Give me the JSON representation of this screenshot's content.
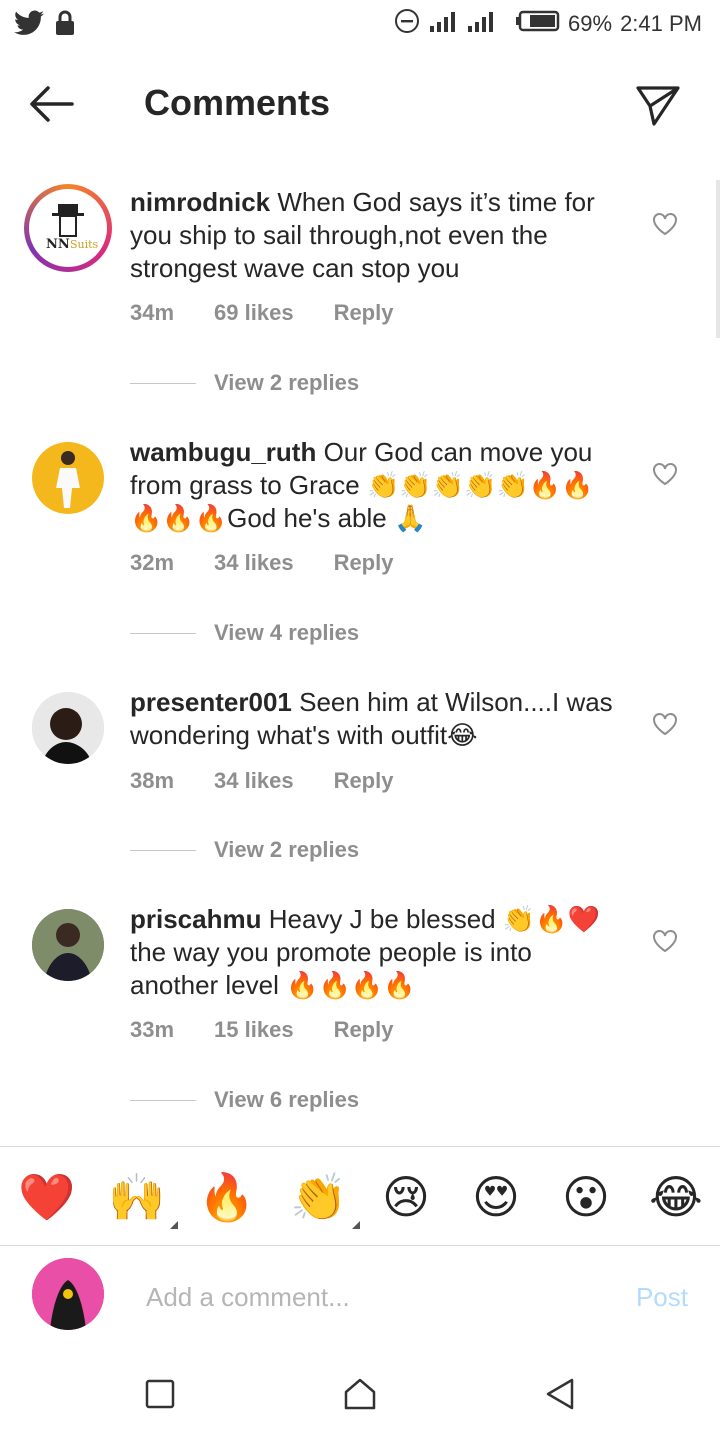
{
  "status_bar": {
    "battery": "69%",
    "time": "2:41 PM"
  },
  "header": {
    "title": "Comments"
  },
  "comments": [
    {
      "username": "nimrodnick",
      "text": "When God says it’s time for you ship to sail through,not even the strongest wave can stop you",
      "time": "34m",
      "likes": "69 likes",
      "reply": "Reply",
      "view_replies": "View 2 replies"
    },
    {
      "username": "wambugu_ruth",
      "text": "Our God can move you from grass to Grace 👏👏👏👏👏🔥🔥🔥🔥🔥God he's able 🙏",
      "time": "32m",
      "likes": "34 likes",
      "reply": "Reply",
      "view_replies": "View 4 replies"
    },
    {
      "username": "presenter001",
      "text": "Seen him at Wilson....I was wondering what's with outfit😂",
      "time": "38m",
      "likes": "34 likes",
      "reply": "Reply",
      "view_replies": "View 2 replies"
    },
    {
      "username": "priscahmu",
      "text": "Heavy J be blessed 👏🔥❤️ the way you promote people is into another level 🔥🔥🔥🔥",
      "time": "33m",
      "likes": "15 likes",
      "reply": "Reply",
      "view_replies": "View 6 replies"
    }
  ],
  "reactions": [
    "❤️",
    "🙌",
    "🔥",
    "👏",
    "😢",
    "😍",
    "😮",
    "😂"
  ],
  "composer": {
    "placeholder": "Add a comment...",
    "post_label": "Post"
  },
  "colors": {
    "accent_disabled": "#b3dbff",
    "meta": "#8e8e8e",
    "text": "#262626"
  }
}
